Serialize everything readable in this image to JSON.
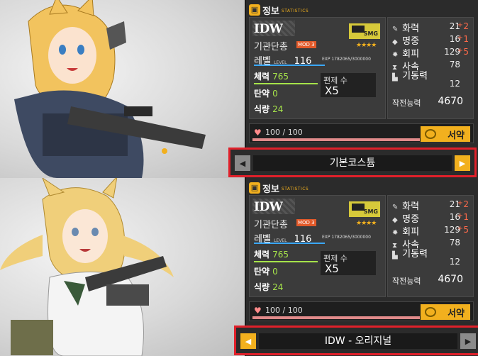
{
  "colors": {
    "accent_gold": "#f2b01e",
    "highlight_red": "#e0202a",
    "hp_green": "#a6e34a",
    "bonus_red": "#ff6a4a",
    "panel_dark": "#2b2b2b"
  },
  "panels": [
    {
      "header": {
        "title": "정보",
        "subtitle": "STATISTICS",
        "icon": "cube-icon"
      },
      "doll": {
        "name": "IDW",
        "class": "기관단총",
        "mod": "MOD 3",
        "weapon_type": "SMG",
        "stars": "★★★★",
        "level_label": "레벨",
        "level_small": "LEVEL",
        "level": "116",
        "exp": "EXP 1782065/3000000",
        "hp_label": "체력",
        "hp": "765",
        "ammo_label": "탄약",
        "ammo": "0",
        "ration_label": "식량",
        "ration": "24",
        "echelon_label": "편제 수",
        "echelon": "X5"
      },
      "attributes": [
        {
          "label": "화력",
          "value": "21",
          "bonus": "2",
          "icon": "firepower-icon"
        },
        {
          "label": "명중",
          "value": "16",
          "bonus": "1",
          "icon": "accuracy-icon"
        },
        {
          "label": "회피",
          "value": "129",
          "bonus": "5",
          "icon": "evasion-icon"
        },
        {
          "label": "사속",
          "value": "78",
          "bonus": "",
          "icon": "rate-of-fire-icon"
        },
        {
          "label": "기동력",
          "value": "12",
          "bonus": "",
          "icon": "mobility-icon"
        }
      ],
      "combat_label": "작전능력",
      "combat_value": "4670",
      "affection": "100 / 100",
      "oath_label": "서약",
      "skin": {
        "name": "기본코스튬",
        "left_active": false,
        "right_active": true
      }
    },
    {
      "header": {
        "title": "정보",
        "subtitle": "STATISTICS",
        "icon": "cube-icon"
      },
      "doll": {
        "name": "IDW",
        "class": "기관단총",
        "mod": "MOD 3",
        "weapon_type": "SMG",
        "stars": "★★★★",
        "level_label": "레벨",
        "level_small": "LEVEL",
        "level": "116",
        "exp": "EXP 1782065/3000000",
        "hp_label": "체력",
        "hp": "765",
        "ammo_label": "탄약",
        "ammo": "0",
        "ration_label": "식량",
        "ration": "24",
        "echelon_label": "편제 수",
        "echelon": "X5"
      },
      "attributes": [
        {
          "label": "화력",
          "value": "21",
          "bonus": "2",
          "icon": "firepower-icon"
        },
        {
          "label": "명중",
          "value": "16",
          "bonus": "1",
          "icon": "accuracy-icon"
        },
        {
          "label": "회피",
          "value": "129",
          "bonus": "5",
          "icon": "evasion-icon"
        },
        {
          "label": "사속",
          "value": "78",
          "bonus": "",
          "icon": "rate-of-fire-icon"
        },
        {
          "label": "기동력",
          "value": "12",
          "bonus": "",
          "icon": "mobility-icon"
        }
      ],
      "combat_label": "작전능력",
      "combat_value": "4670",
      "affection": "100 / 100",
      "oath_label": "서약",
      "skin": {
        "name": "IDW - 오리지널",
        "left_active": true,
        "right_active": false
      }
    }
  ]
}
